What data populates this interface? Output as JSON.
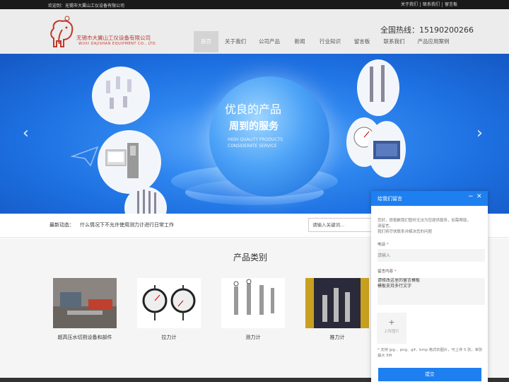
{
  "topbar": {
    "welcome": "欢迎到：无锡市大翼山工仪设备有限公司",
    "links": [
      "关于我们",
      "联系我们",
      "留言板"
    ]
  },
  "header": {
    "company_name": "无锡市大翼山工仪设备有限公司",
    "company_en": "WUXI DAJISHAN EQUIPMENT CO., LTD.",
    "hotline": "全国热线：15190200266"
  },
  "nav": {
    "items": [
      "首页",
      "关于我们",
      "公司产品",
      "新闻",
      "行业知识",
      "留言板",
      "联系我们",
      "产品应用案例"
    ],
    "active_index": 0
  },
  "banner": {
    "headline1": "优良的产品",
    "headline2": "周到的服务",
    "en_line1": "HIGH QUALITY PRODUCTS",
    "en_line2": "CONSIDERATE SERVICE"
  },
  "news": {
    "label": "最新动态：",
    "text": "什么情况下不允许使用测力计进行日常工作"
  },
  "search": {
    "placeholder": "请输入关键词..."
  },
  "products": {
    "title": "产品类别",
    "items": [
      {
        "name": "超高压水切割设备和部件"
      },
      {
        "name": "拉力计"
      },
      {
        "name": "测力计"
      },
      {
        "name": "推力计"
      }
    ]
  },
  "message_panel": {
    "title": "给我们留言",
    "minimize_icon": "minimize-icon",
    "close_icon": "close-icon",
    "desc_line1": "您好，很抱歉我们暂时无法为您提供服务，如需帮助，",
    "desc_line2": "请留言，",
    "desc_line3": "我们将尽快联系并解决您的问题",
    "phone_label": "电话",
    "phone_placeholder": "请输入",
    "content_label": "留言内容",
    "content_value": "请修改这里的留言模板\n模板支持多行文字",
    "upload_label": "上传图片",
    "note": "* 支持 jpg 、png、gif、bmp 格式的图片，可上传 5 张，单张最大 5M",
    "submit_label": "提交",
    "accent_color": "#1e7ff0"
  },
  "colors": {
    "topbar": "#1a1a1a",
    "header_bg": "#ececec",
    "brand_red": "#c0392b",
    "banner_blue": "#2f86ef"
  }
}
